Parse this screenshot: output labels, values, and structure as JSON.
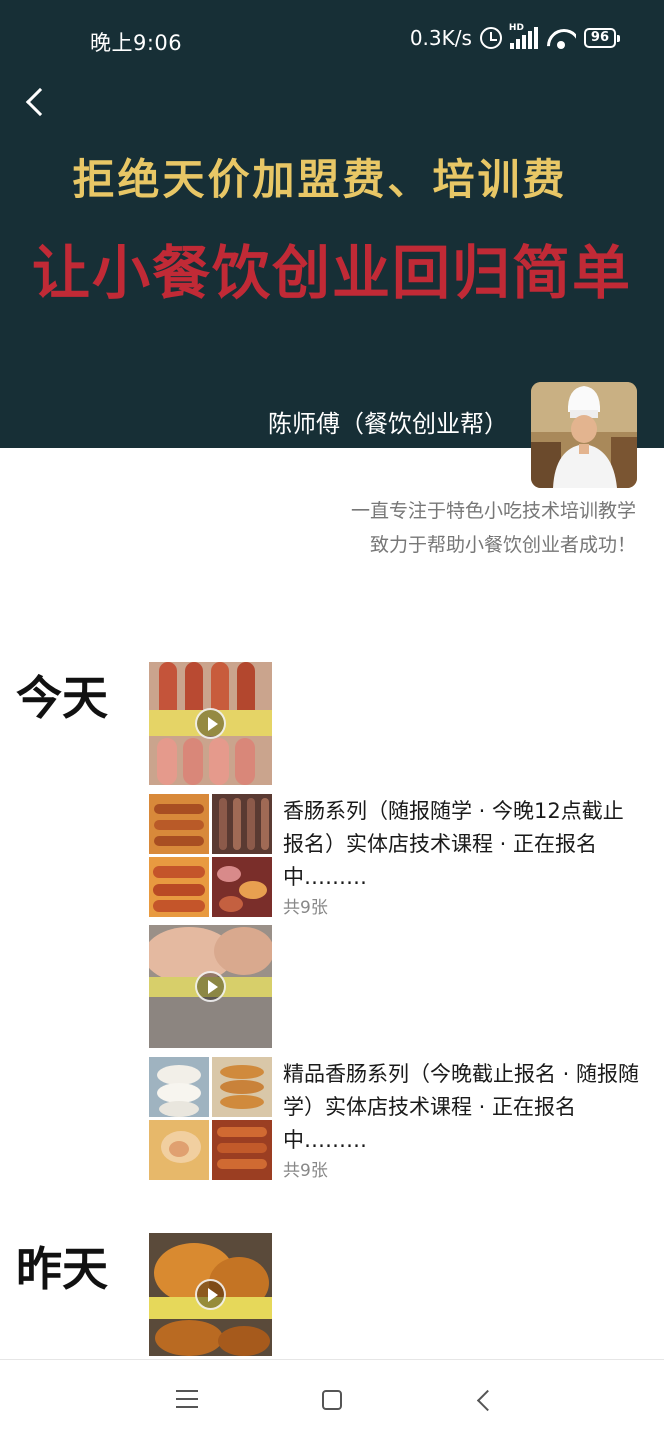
{
  "status_bar": {
    "time": "晚上9:06",
    "net_speed": "0.3K/s",
    "network_type": "HD",
    "battery": "96",
    "icons": [
      "alarm-icon",
      "signal-icon",
      "wifi-icon",
      "battery-icon"
    ]
  },
  "header": {
    "headline_1": "拒绝天价加盟费、培训费",
    "headline_2": "让小餐饮创业回归简单",
    "owner_name": "陈师傅（餐饮创业帮）",
    "bio_lines": [
      "一直专注于特色小吃技术培训教学",
      "致力于帮助小餐饮创业者成功！"
    ]
  },
  "colors": {
    "cover_bg": "#172f36",
    "headline_1": "#e8c766",
    "headline_2": "#c12a36"
  },
  "feed": {
    "sections": [
      {
        "day": "今天",
        "posts": [
          {
            "text": "香肠系列（随报随学 · 今晚12点截止报名）实体店技术课程 · 正在报名中………",
            "count": "共9张"
          },
          {
            "text": "精品香肠系列（今晚截止报名 · 随报随学）实体店技术课程 · 正在报名中………",
            "count": "共9张"
          }
        ]
      },
      {
        "day": "昨天",
        "posts": []
      }
    ]
  },
  "nav_bar": {
    "icons": [
      "menu-icon",
      "home-icon",
      "back-icon"
    ]
  }
}
